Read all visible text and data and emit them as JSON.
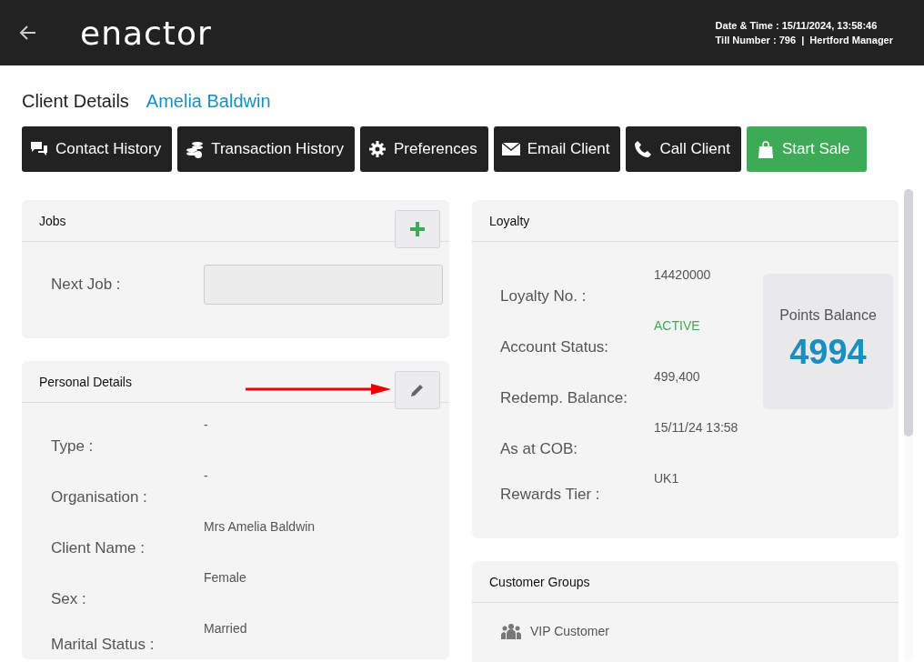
{
  "header": {
    "logo": "enactor",
    "date_time": "Date & Time : 15/11/2024, 13:58:46",
    "till_info": "Till Number : 796  |  Hertford Manager"
  },
  "page": {
    "title": "Client Details",
    "client_name": "Amelia Baldwin"
  },
  "actions": [
    {
      "label": "Contact History",
      "kind": "default"
    },
    {
      "label": "Transaction History",
      "kind": "default"
    },
    {
      "label": "Preferences",
      "kind": "default"
    },
    {
      "label": "Email Client",
      "kind": "default"
    },
    {
      "label": "Call Client",
      "kind": "default"
    },
    {
      "label": "Start Sale",
      "kind": "primary"
    }
  ],
  "jobs": {
    "title": "Jobs",
    "field_label": "Next Job :"
  },
  "personal_details": {
    "title": "Personal Details",
    "fields": [
      {
        "label": "Type :",
        "value": "-"
      },
      {
        "label": "Organisation :",
        "value": "-"
      },
      {
        "label": "Client Name :",
        "value": "Mrs Amelia Baldwin"
      },
      {
        "label": "Sex :",
        "value": "Female"
      },
      {
        "label": "Marital Status :",
        "value": "Married"
      }
    ]
  },
  "loyalty": {
    "title": "Loyalty",
    "fields": [
      {
        "label": "Loyalty No. :",
        "value": "14420000",
        "kind": "plain"
      },
      {
        "label": "Account Status:",
        "value": "ACTIVE",
        "kind": "status"
      },
      {
        "label": "Redemp. Balance:",
        "value": "499,400",
        "kind": "plain"
      },
      {
        "label": "As at COB:",
        "value": "15/11/24 13:58",
        "kind": "plain"
      },
      {
        "label": "Rewards Tier :",
        "value": "UK1",
        "kind": "plain"
      }
    ],
    "points_label": "Points Balance",
    "points_value": "4994"
  },
  "customer_groups": {
    "title": "Customer Groups",
    "items": [
      "VIP Customer"
    ]
  }
}
